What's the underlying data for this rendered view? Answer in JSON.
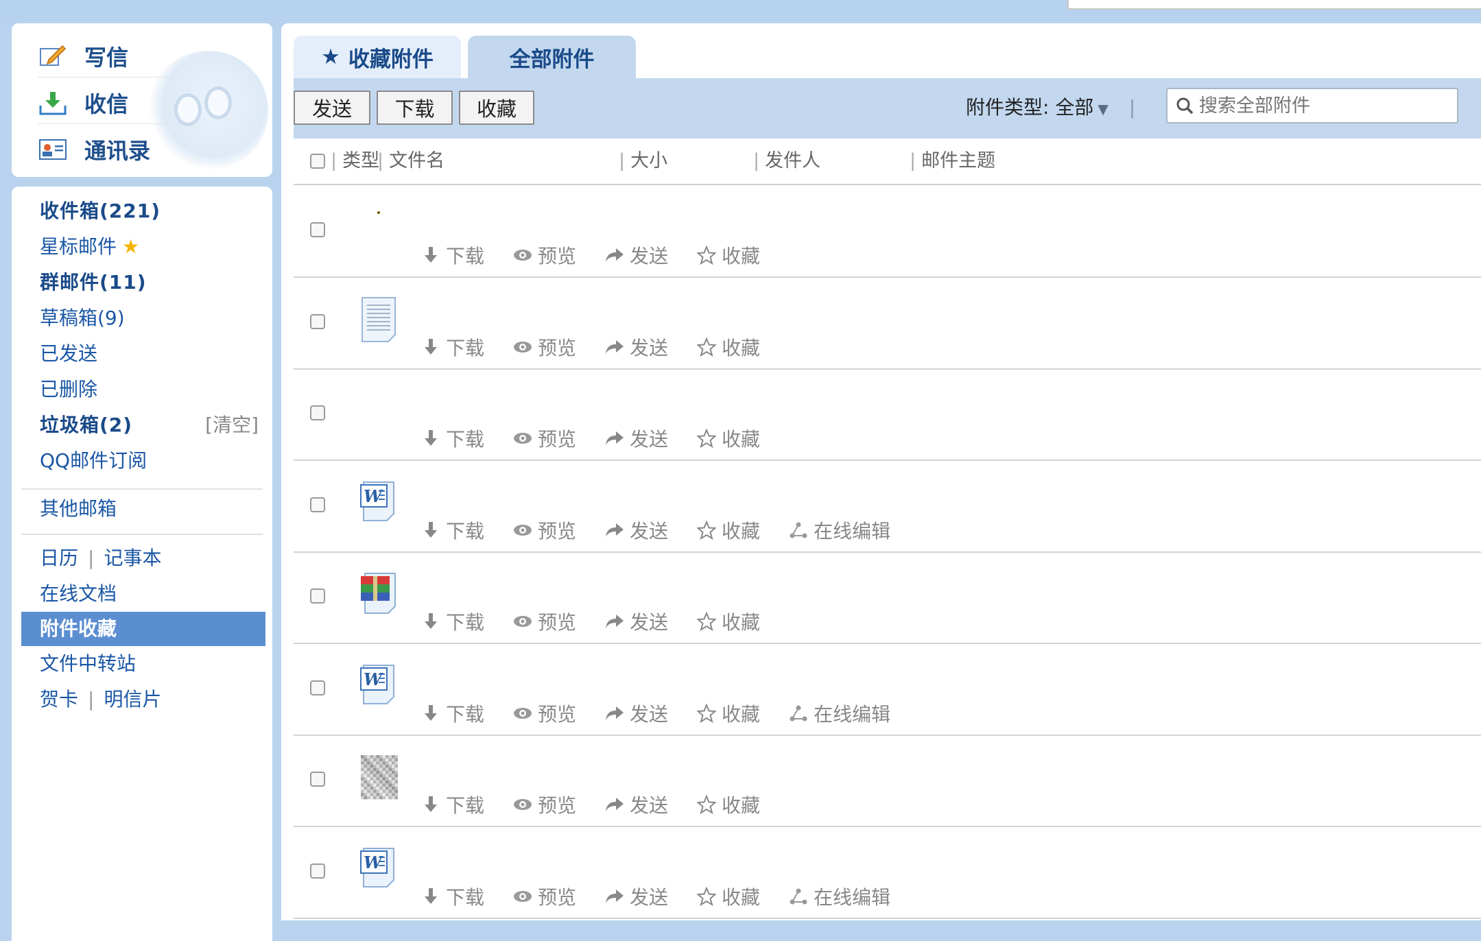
{
  "quick": {
    "compose": "写信",
    "receive": "收信",
    "contacts": "通讯录"
  },
  "nav": {
    "inbox": "收件箱(221)",
    "starred": "星标邮件",
    "group": "群邮件(11)",
    "drafts": "草稿箱(9)",
    "sent": "已发送",
    "deleted": "已删除",
    "spam": "垃圾箱(2)",
    "spam_clear": "[清空]",
    "subscribe": "QQ邮件订阅",
    "other_mailbox": "其他邮箱",
    "calendar": "日历",
    "notes": "记事本",
    "online_docs": "在线文档",
    "attachment_fav": "附件收藏",
    "file_transfer": "文件中转站",
    "greeting_card": "贺卡",
    "postcard": "明信片",
    "separator": "|"
  },
  "tabs": {
    "fav_star": "★",
    "fav": "收藏附件",
    "all": "全部附件"
  },
  "toolbar": {
    "send": "发送",
    "download": "下载",
    "favorite": "收藏",
    "type_label": "附件类型:",
    "type_value": "全部",
    "type_arrow": "▼",
    "bar": "|",
    "search_placeholder": "搜索全部附件"
  },
  "columns": {
    "type": "类型",
    "filename": "文件名",
    "size": "大小",
    "sender": "发件人",
    "subject": "邮件主题"
  },
  "actions": {
    "download": "下载",
    "preview": "预览",
    "send": "发送",
    "favorite": "收藏",
    "edit_online": "在线编辑"
  },
  "rows": [
    {
      "icon": "dot-icon",
      "online_edit": false
    },
    {
      "icon": "text-file-icon",
      "online_edit": false
    },
    {
      "icon": "none",
      "online_edit": false
    },
    {
      "icon": "word-file-icon",
      "online_edit": true
    },
    {
      "icon": "archive-file-icon",
      "online_edit": false
    },
    {
      "icon": "word-file-icon",
      "online_edit": true
    },
    {
      "icon": "image-thumbnail-icon",
      "online_edit": false
    },
    {
      "icon": "word-file-icon",
      "online_edit": true
    }
  ],
  "colors": {
    "background": "#b9d3ef",
    "toolbar": "#c3d8ef",
    "selected_nav": "#5b8ed1",
    "link": "#1a57a5"
  }
}
